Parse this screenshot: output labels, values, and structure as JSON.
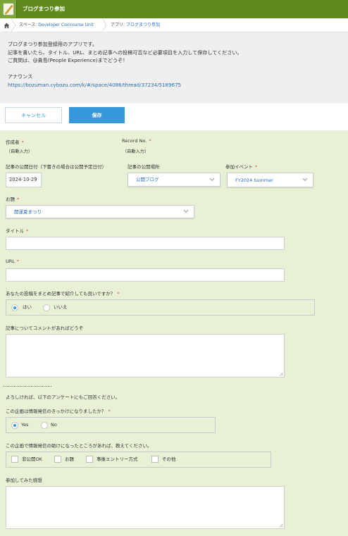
{
  "header": {
    "app_title": "ブログまつり参加",
    "app_icon": "pencil-icon",
    "color": "#5f8a1e"
  },
  "breadcrumb": {
    "home_icon": "home-icon",
    "space_prefix": "スペース: ",
    "space_name": "Developer Concourse Unit",
    "app_prefix": "アプリ: ",
    "app_name": "ブログまつり参加"
  },
  "description": {
    "line1": "ブログまつり参加登録用のアプリです。",
    "line2": "記事を書いたら、タイトル、URL、まとめ記事への投稿可否など必要項目を入力して保存してください。",
    "line3": "ご質問は、@貴島(People Experience)までどうぞ！",
    "announce_label": "アナウンス",
    "announce_url": "https://bozuman.cybozu.com/k/#/space/4086/thread/37234/5189675"
  },
  "toolbar": {
    "cancel_label": "キャンセル",
    "save_label": "保存",
    "accent": "#3498db"
  },
  "form": {
    "author": {
      "label": "作成者",
      "value": "（自動入力）"
    },
    "record_no": {
      "label": "Record No.",
      "value": "（自動入力）"
    },
    "publish_date": {
      "label": "記事の公開日付（下書きの場合は公開予定日付）",
      "value": "2024-10-29"
    },
    "publish_place": {
      "label": "記事の公開場所",
      "value": "公開ブログ"
    },
    "event": {
      "label": "参加イベント",
      "value": "FY2024 Summer"
    },
    "topic": {
      "label": "お題",
      "value": "開運夏まつり"
    },
    "title": {
      "label": "タイトル",
      "value": ""
    },
    "url": {
      "label": "URL",
      "value": ""
    },
    "roundup": {
      "label": "あなたの投稿をまとめ記事で紹介しても良いですか？",
      "options": [
        "はい",
        "いいえ"
      ],
      "selected": "はい"
    },
    "comment": {
      "label": "記事についてコメントがあればどうぞ",
      "value": ""
    },
    "survey_intro": "よろしければ、以下のアンケートにもご回答ください。",
    "trigger": {
      "label": "この企画は情報発信のきっかけになりましたか？",
      "options": [
        "Yes",
        "No"
      ],
      "selected": "Yes"
    },
    "helpful": {
      "label": "この企画で情報発信の助けになったところがあれば、教えてください。",
      "options": [
        "非公開OK",
        "お題",
        "事後エントリー方式",
        "その他"
      ]
    },
    "impression": {
      "label": "参加してみた感想",
      "value": ""
    }
  }
}
